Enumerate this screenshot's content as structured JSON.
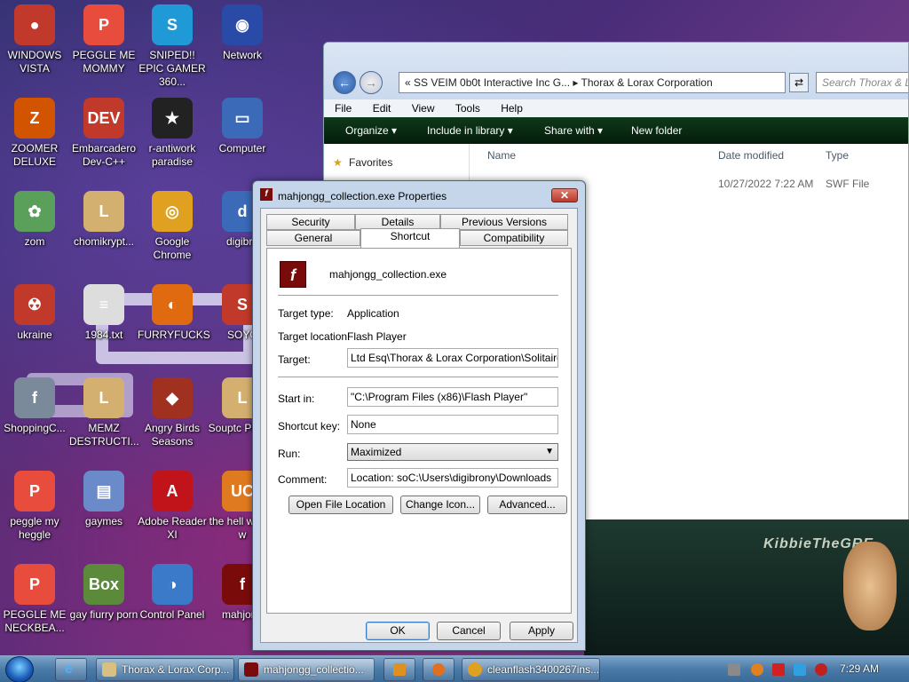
{
  "desktop_icons": [
    {
      "label": "WINDOWS VISTA",
      "color": "#c0392b",
      "glyph": "●"
    },
    {
      "label": "PEGGLE ME MOMMY",
      "color": "#e74c3c",
      "glyph": "P"
    },
    {
      "label": "SNIPED!! EPIC GAMER 360...",
      "color": "#1f9ad6",
      "glyph": "S"
    },
    {
      "label": "Network",
      "color": "#2a4aa8",
      "glyph": "◉"
    },
    {
      "label": "ZOOMER DELUXE",
      "color": "#d35400",
      "glyph": "Z"
    },
    {
      "label": "Embarcadero Dev-C++",
      "color": "#c0392b",
      "glyph": "DEV"
    },
    {
      "label": "r-antiwork paradise",
      "color": "#222222",
      "glyph": "★"
    },
    {
      "label": "Computer",
      "color": "#3a6ab8",
      "glyph": "▭"
    },
    {
      "label": "zom",
      "color": "#5aa05a",
      "glyph": "✿"
    },
    {
      "label": "chomikrypt...",
      "color": "#d4b070",
      "glyph": "L"
    },
    {
      "label": "Google Chrome",
      "color": "#e0a020",
      "glyph": "◎"
    },
    {
      "label": "digibro",
      "color": "#3a6ab8",
      "glyph": "d"
    },
    {
      "label": "ukraine",
      "color": "#c0392b",
      "glyph": "☢"
    },
    {
      "label": "1984.txt",
      "color": "#dddddd",
      "glyph": "≡"
    },
    {
      "label": "FURRYFUCKS",
      "color": "#e06a10",
      "glyph": "◐"
    },
    {
      "label": "SOYC",
      "color": "#c0392b",
      "glyph": "S"
    },
    {
      "label": "ShoppingC...",
      "color": "#7a8a9a",
      "glyph": "f"
    },
    {
      "label": "MEMZ DESTRUCTI...",
      "color": "#d4b070",
      "glyph": "L"
    },
    {
      "label": "Angry Birds Seasons",
      "color": "#a03020",
      "glyph": "◆"
    },
    {
      "label": "Souptc Playse",
      "color": "#d4b070",
      "glyph": "L"
    },
    {
      "label": "peggle my heggle",
      "color": "#e74c3c",
      "glyph": "P"
    },
    {
      "label": "gaymes",
      "color": "#6a8aca",
      "glyph": "▤"
    },
    {
      "label": "Adobe Reader XI",
      "color": "#c0141a",
      "glyph": "A"
    },
    {
      "label": "the hell wrong w",
      "color": "#e07a20",
      "glyph": "UC"
    },
    {
      "label": "PEGGLE ME NECKBEA...",
      "color": "#e74c3c",
      "glyph": "P"
    },
    {
      "label": "gay fiurry porn",
      "color": "#5a8a3a",
      "glyph": "Box"
    },
    {
      "label": "Control Panel",
      "color": "#3a7ac8",
      "glyph": "◑"
    },
    {
      "label": "mahjong",
      "color": "#7a0b0b",
      "glyph": "f"
    }
  ],
  "explorer": {
    "address": "«  SS VEIM 0b0t Interactive Inc G...  ▸  Thorax & Lorax Corporation",
    "search_placeholder": "Search Thorax & Lorax",
    "menu": [
      "File",
      "Edit",
      "View",
      "Tools",
      "Help"
    ],
    "commands": [
      "Organize ▾",
      "Include in library ▾",
      "Share with ▾",
      "New folder"
    ],
    "nav_favorites": "Favorites",
    "columns": [
      "Name",
      "Date modified",
      "Type"
    ],
    "row": {
      "date": "10/27/2022 7:22 AM",
      "type": "SWF File"
    }
  },
  "wallpaper_text": "KibbieTheGRE",
  "dialog": {
    "title": "mahjongg_collection.exe Properties",
    "close_label": "✕",
    "tabs_row1": [
      "Security",
      "Details",
      "Previous Versions"
    ],
    "tabs_row2": [
      "General",
      "Shortcut",
      "Compatibility"
    ],
    "active_tab": "Shortcut",
    "filename": "mahjongg_collection.exe",
    "target_type_label": "Target type:",
    "target_type": "Application",
    "target_location_label": "Target location:",
    "target_location": "Flash Player",
    "target_label": "Target:",
    "target": "Ltd Esq\\Thorax & Lorax Corporation\\Solitaire.swf\"",
    "start_in_label": "Start in:",
    "start_in": "\"C:\\Program Files (x86)\\Flash Player\"",
    "shortcut_key_label": "Shortcut key:",
    "shortcut_key": "None",
    "run_label": "Run:",
    "run": "Maximized",
    "comment_label": "Comment:",
    "comment": "Location: soC:\\Users\\digibrony\\Downloads",
    "open_file_location": "Open File Location",
    "change_icon": "Change Icon...",
    "advanced": "Advanced...",
    "ok": "OK",
    "cancel": "Cancel",
    "apply": "Apply"
  },
  "taskbar": {
    "items": [
      "Thorax & Lorax Corp...",
      "mahjongg_collectio...",
      "cleanflash3400267ins..."
    ],
    "clock": "7:29 AM"
  }
}
